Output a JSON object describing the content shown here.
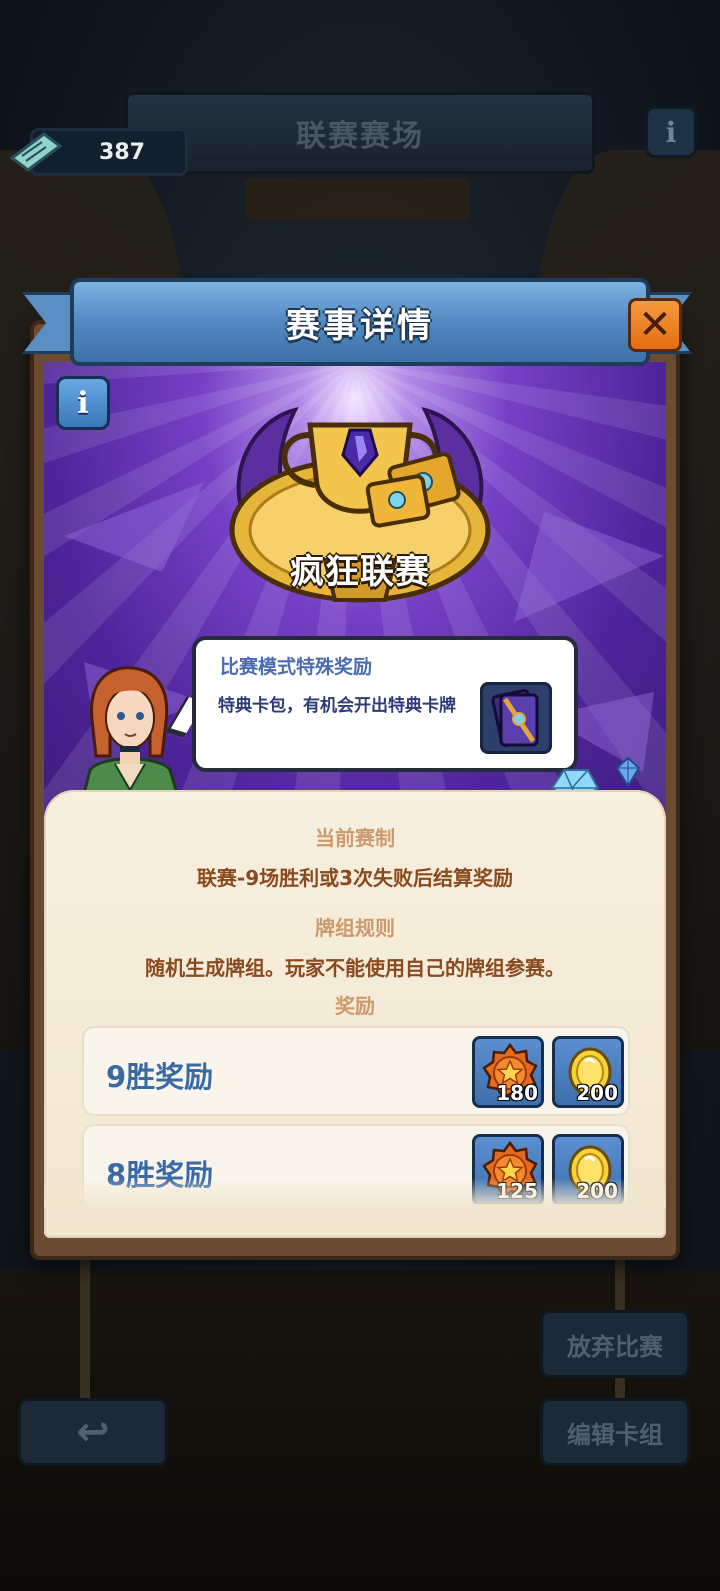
{
  "header": {
    "title": "联赛赛场",
    "ticket_count": "387"
  },
  "modal": {
    "title": "赛事详情",
    "event_name": "疯狂联赛",
    "bubble": {
      "title": "比赛模式特殊奖励",
      "text": "特典卡包，有机会开出特典卡牌"
    },
    "format_heading": "当前赛制",
    "format_text": "联赛-9场胜利或3次失败后结算奖励",
    "deck_heading": "牌组规则",
    "deck_text": "随机生成牌组。玩家不能使用自己的牌组参赛。",
    "rewards_heading": "奖励",
    "rewards": [
      {
        "label": "9胜奖励",
        "items": [
          {
            "icon": "star-medal-icon",
            "amount": "180"
          },
          {
            "icon": "gold-coin-icon",
            "amount": "200"
          }
        ]
      },
      {
        "label": "8胜奖励",
        "items": [
          {
            "icon": "star-medal-icon",
            "amount": "125"
          },
          {
            "icon": "gold-coin-icon",
            "amount": "200"
          }
        ]
      }
    ]
  },
  "buttons": {
    "abandon": "放弃比赛",
    "edit_deck": "编辑卡组",
    "back": "↩"
  },
  "colors": {
    "ribbon": "#4e86bf",
    "close": "#e36e14",
    "hero_purple": "#7640c6",
    "parchment": "#f1e6d0",
    "reward_label": "#3a6aa6",
    "section_heading": "#cc9a6b",
    "section_body": "#8a4a1e"
  }
}
